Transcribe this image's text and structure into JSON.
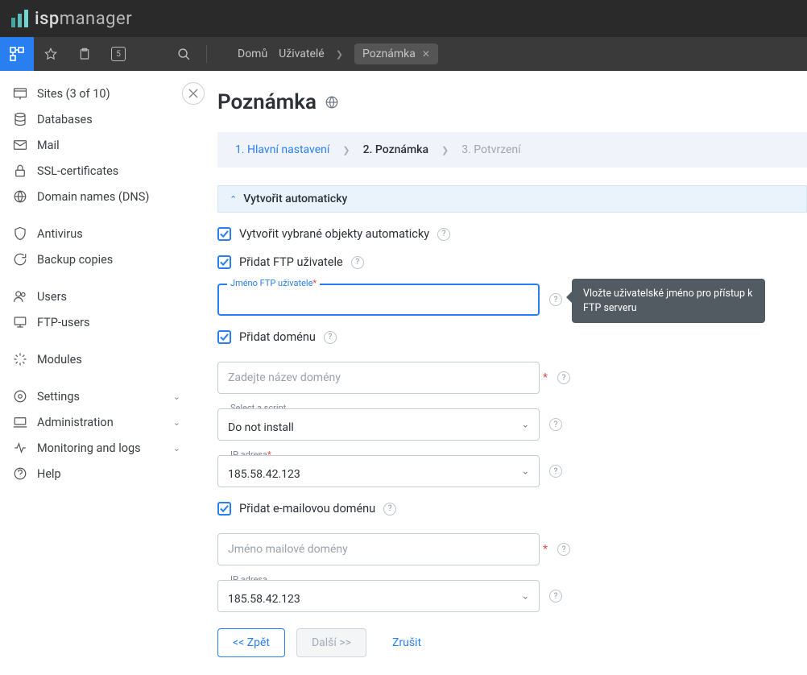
{
  "brand": {
    "light": "isp",
    "heavy": "manager"
  },
  "toolbar": {
    "badge": "5"
  },
  "breadcrumb": {
    "home": "Domů",
    "users": "Uživatelé",
    "current": "Poznámka"
  },
  "sidebar": {
    "sites": "Sites (3 of 10)",
    "databases": "Databases",
    "mail": "Mail",
    "ssl": "SSL-certificates",
    "dns": "Domain names (DNS)",
    "antivirus": "Antivirus",
    "backup": "Backup copies",
    "users": "Users",
    "ftp": "FTP-users",
    "modules": "Modules",
    "settings": "Settings",
    "administration": "Administration",
    "monitoring": "Monitoring and logs",
    "help": "Help"
  },
  "page": {
    "title": "Poznámka"
  },
  "steps": {
    "s1": "1. Hlavní nastavení",
    "s2": "2. Poznámka",
    "s3": "3. Potvrzení"
  },
  "section": {
    "auto": "Vytvořit automaticky"
  },
  "form": {
    "auto_create": "Vytvořit vybrané objekty automaticky",
    "add_ftp": "Přidat FTP uživatele",
    "ftp_name_label": "Jméno FTP uživatele",
    "add_domain": "Přidat doménu",
    "domain_placeholder": "Zadejte název domény",
    "script_label": "Select a script",
    "script_value": "Do not install",
    "ip_label": "IP adresa",
    "ip_value": "185.58.42.123",
    "add_mail_domain": "Přidat e-mailovou doménu",
    "mail_domain_placeholder": "Jméno mailové domény",
    "ip2_label": "IP adresa",
    "ip2_value": "185.58.42.123"
  },
  "tooltip": {
    "ftp": "Vložte uživatelské jméno pro přístup k FTP serveru"
  },
  "buttons": {
    "back": "<< Zpět",
    "next": "Další >>",
    "cancel": "Zrušit"
  },
  "required_marker": "*"
}
